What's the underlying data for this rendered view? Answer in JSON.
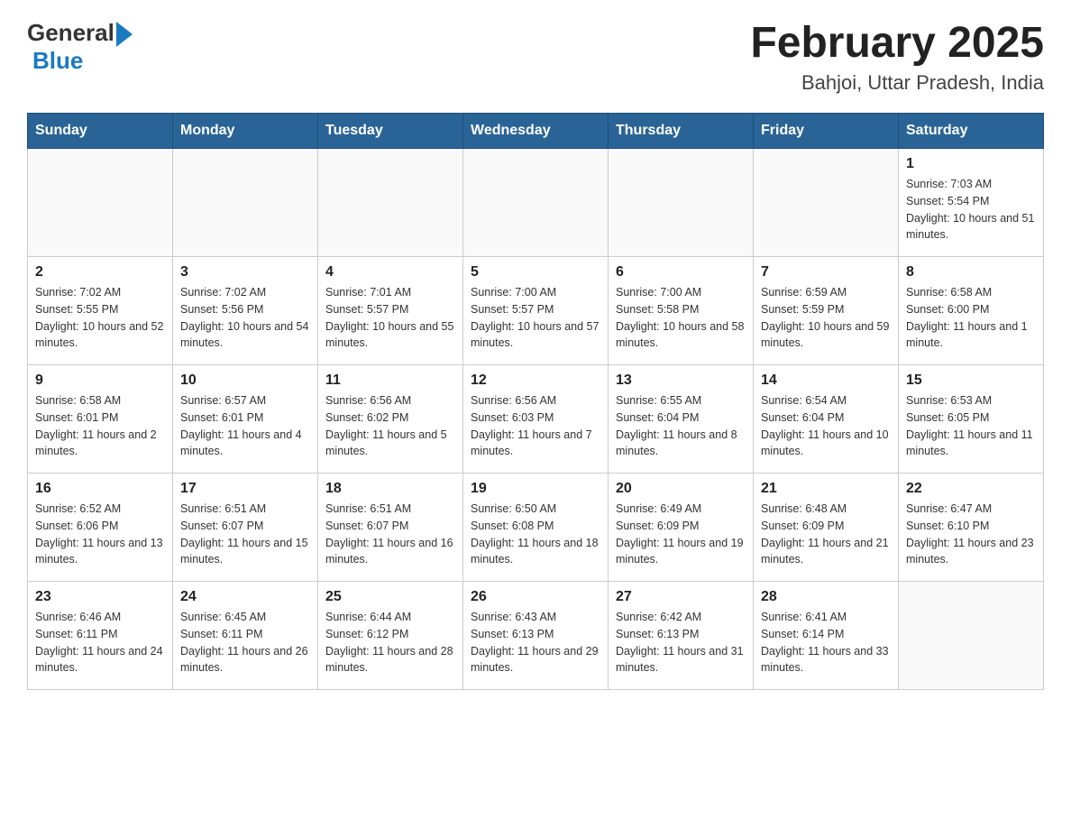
{
  "header": {
    "logo_general": "General",
    "logo_blue": "Blue",
    "month_title": "February 2025",
    "location": "Bahjoi, Uttar Pradesh, India"
  },
  "weekdays": [
    "Sunday",
    "Monday",
    "Tuesday",
    "Wednesday",
    "Thursday",
    "Friday",
    "Saturday"
  ],
  "weeks": [
    [
      {
        "day": "",
        "sunrise": "",
        "sunset": "",
        "daylight": ""
      },
      {
        "day": "",
        "sunrise": "",
        "sunset": "",
        "daylight": ""
      },
      {
        "day": "",
        "sunrise": "",
        "sunset": "",
        "daylight": ""
      },
      {
        "day": "",
        "sunrise": "",
        "sunset": "",
        "daylight": ""
      },
      {
        "day": "",
        "sunrise": "",
        "sunset": "",
        "daylight": ""
      },
      {
        "day": "",
        "sunrise": "",
        "sunset": "",
        "daylight": ""
      },
      {
        "day": "1",
        "sunrise": "Sunrise: 7:03 AM",
        "sunset": "Sunset: 5:54 PM",
        "daylight": "Daylight: 10 hours and 51 minutes."
      }
    ],
    [
      {
        "day": "2",
        "sunrise": "Sunrise: 7:02 AM",
        "sunset": "Sunset: 5:55 PM",
        "daylight": "Daylight: 10 hours and 52 minutes."
      },
      {
        "day": "3",
        "sunrise": "Sunrise: 7:02 AM",
        "sunset": "Sunset: 5:56 PM",
        "daylight": "Daylight: 10 hours and 54 minutes."
      },
      {
        "day": "4",
        "sunrise": "Sunrise: 7:01 AM",
        "sunset": "Sunset: 5:57 PM",
        "daylight": "Daylight: 10 hours and 55 minutes."
      },
      {
        "day": "5",
        "sunrise": "Sunrise: 7:00 AM",
        "sunset": "Sunset: 5:57 PM",
        "daylight": "Daylight: 10 hours and 57 minutes."
      },
      {
        "day": "6",
        "sunrise": "Sunrise: 7:00 AM",
        "sunset": "Sunset: 5:58 PM",
        "daylight": "Daylight: 10 hours and 58 minutes."
      },
      {
        "day": "7",
        "sunrise": "Sunrise: 6:59 AM",
        "sunset": "Sunset: 5:59 PM",
        "daylight": "Daylight: 10 hours and 59 minutes."
      },
      {
        "day": "8",
        "sunrise": "Sunrise: 6:58 AM",
        "sunset": "Sunset: 6:00 PM",
        "daylight": "Daylight: 11 hours and 1 minute."
      }
    ],
    [
      {
        "day": "9",
        "sunrise": "Sunrise: 6:58 AM",
        "sunset": "Sunset: 6:01 PM",
        "daylight": "Daylight: 11 hours and 2 minutes."
      },
      {
        "day": "10",
        "sunrise": "Sunrise: 6:57 AM",
        "sunset": "Sunset: 6:01 PM",
        "daylight": "Daylight: 11 hours and 4 minutes."
      },
      {
        "day": "11",
        "sunrise": "Sunrise: 6:56 AM",
        "sunset": "Sunset: 6:02 PM",
        "daylight": "Daylight: 11 hours and 5 minutes."
      },
      {
        "day": "12",
        "sunrise": "Sunrise: 6:56 AM",
        "sunset": "Sunset: 6:03 PM",
        "daylight": "Daylight: 11 hours and 7 minutes."
      },
      {
        "day": "13",
        "sunrise": "Sunrise: 6:55 AM",
        "sunset": "Sunset: 6:04 PM",
        "daylight": "Daylight: 11 hours and 8 minutes."
      },
      {
        "day": "14",
        "sunrise": "Sunrise: 6:54 AM",
        "sunset": "Sunset: 6:04 PM",
        "daylight": "Daylight: 11 hours and 10 minutes."
      },
      {
        "day": "15",
        "sunrise": "Sunrise: 6:53 AM",
        "sunset": "Sunset: 6:05 PM",
        "daylight": "Daylight: 11 hours and 11 minutes."
      }
    ],
    [
      {
        "day": "16",
        "sunrise": "Sunrise: 6:52 AM",
        "sunset": "Sunset: 6:06 PM",
        "daylight": "Daylight: 11 hours and 13 minutes."
      },
      {
        "day": "17",
        "sunrise": "Sunrise: 6:51 AM",
        "sunset": "Sunset: 6:07 PM",
        "daylight": "Daylight: 11 hours and 15 minutes."
      },
      {
        "day": "18",
        "sunrise": "Sunrise: 6:51 AM",
        "sunset": "Sunset: 6:07 PM",
        "daylight": "Daylight: 11 hours and 16 minutes."
      },
      {
        "day": "19",
        "sunrise": "Sunrise: 6:50 AM",
        "sunset": "Sunset: 6:08 PM",
        "daylight": "Daylight: 11 hours and 18 minutes."
      },
      {
        "day": "20",
        "sunrise": "Sunrise: 6:49 AM",
        "sunset": "Sunset: 6:09 PM",
        "daylight": "Daylight: 11 hours and 19 minutes."
      },
      {
        "day": "21",
        "sunrise": "Sunrise: 6:48 AM",
        "sunset": "Sunset: 6:09 PM",
        "daylight": "Daylight: 11 hours and 21 minutes."
      },
      {
        "day": "22",
        "sunrise": "Sunrise: 6:47 AM",
        "sunset": "Sunset: 6:10 PM",
        "daylight": "Daylight: 11 hours and 23 minutes."
      }
    ],
    [
      {
        "day": "23",
        "sunrise": "Sunrise: 6:46 AM",
        "sunset": "Sunset: 6:11 PM",
        "daylight": "Daylight: 11 hours and 24 minutes."
      },
      {
        "day": "24",
        "sunrise": "Sunrise: 6:45 AM",
        "sunset": "Sunset: 6:11 PM",
        "daylight": "Daylight: 11 hours and 26 minutes."
      },
      {
        "day": "25",
        "sunrise": "Sunrise: 6:44 AM",
        "sunset": "Sunset: 6:12 PM",
        "daylight": "Daylight: 11 hours and 28 minutes."
      },
      {
        "day": "26",
        "sunrise": "Sunrise: 6:43 AM",
        "sunset": "Sunset: 6:13 PM",
        "daylight": "Daylight: 11 hours and 29 minutes."
      },
      {
        "day": "27",
        "sunrise": "Sunrise: 6:42 AM",
        "sunset": "Sunset: 6:13 PM",
        "daylight": "Daylight: 11 hours and 31 minutes."
      },
      {
        "day": "28",
        "sunrise": "Sunrise: 6:41 AM",
        "sunset": "Sunset: 6:14 PM",
        "daylight": "Daylight: 11 hours and 33 minutes."
      },
      {
        "day": "",
        "sunrise": "",
        "sunset": "",
        "daylight": ""
      }
    ]
  ]
}
